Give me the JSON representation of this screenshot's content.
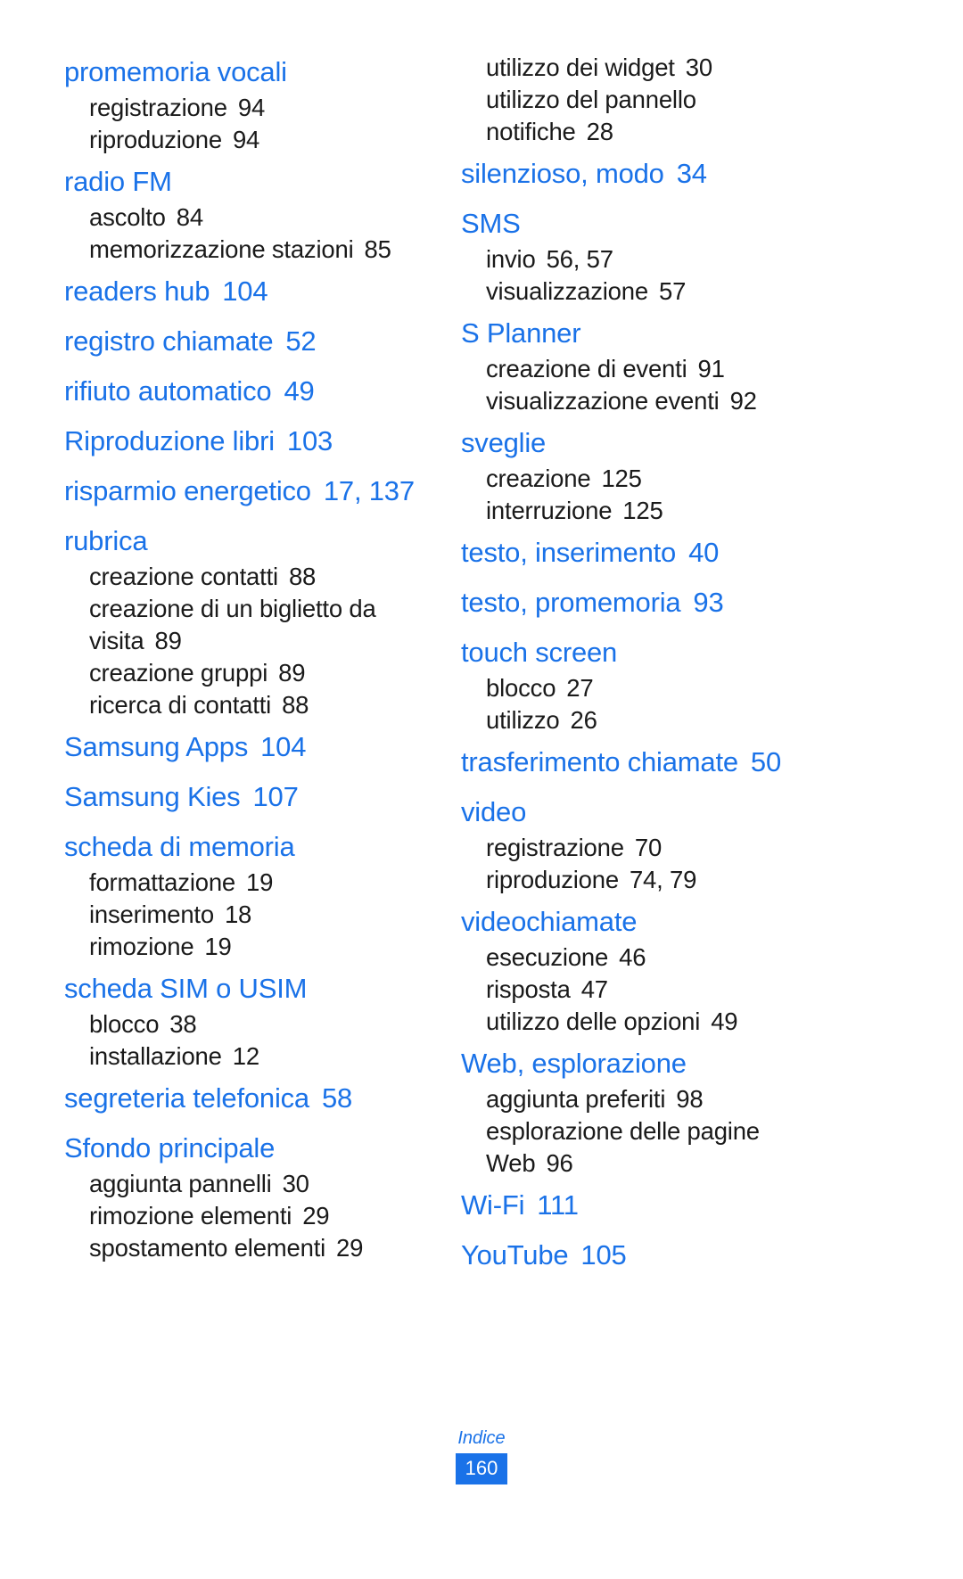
{
  "document": {
    "footer_label": "Indice",
    "page_number": "160",
    "accent_color": "#1a72e8",
    "text_color": "#1a1a1a"
  },
  "columns": [
    {
      "name": "left-column",
      "entries": [
        {
          "head": "promemoria vocali",
          "head_page": "",
          "subs": [
            {
              "label": "registrazione",
              "page": "94"
            },
            {
              "label": "riproduzione",
              "page": "94"
            }
          ]
        },
        {
          "head": "radio FM",
          "head_page": "",
          "subs": [
            {
              "label": "ascolto",
              "page": "84"
            },
            {
              "label": "memorizzazione stazioni",
              "page": "85"
            }
          ]
        },
        {
          "head": "readers hub",
          "head_page": "104",
          "subs": []
        },
        {
          "head": "registro chiamate",
          "head_page": "52",
          "subs": []
        },
        {
          "head": "rifiuto automatico",
          "head_page": "49",
          "subs": []
        },
        {
          "head": "Riproduzione libri",
          "head_page": "103",
          "subs": []
        },
        {
          "head": "risparmio energetico",
          "head_page": "17, 137",
          "subs": []
        },
        {
          "head": "rubrica",
          "head_page": "",
          "subs": [
            {
              "label": "creazione contatti",
              "page": "88"
            },
            {
              "label": "creazione di un biglietto da visita",
              "page": "89"
            },
            {
              "label": "creazione gruppi",
              "page": "89"
            },
            {
              "label": "ricerca di contatti",
              "page": "88"
            }
          ]
        },
        {
          "head": "Samsung Apps",
          "head_page": "104",
          "subs": []
        },
        {
          "head": "Samsung Kies",
          "head_page": "107",
          "subs": []
        },
        {
          "head": "scheda di memoria",
          "head_page": "",
          "subs": [
            {
              "label": "formattazione",
              "page": "19"
            },
            {
              "label": "inserimento",
              "page": "18"
            },
            {
              "label": "rimozione",
              "page": "19"
            }
          ]
        },
        {
          "head": "scheda SIM o USIM",
          "head_page": "",
          "subs": [
            {
              "label": "blocco",
              "page": "38"
            },
            {
              "label": "installazione",
              "page": "12"
            }
          ]
        },
        {
          "head": "segreteria telefonica",
          "head_page": "58",
          "subs": []
        },
        {
          "head": "Sfondo principale",
          "head_page": "",
          "subs": [
            {
              "label": "aggiunta pannelli",
              "page": "30"
            },
            {
              "label": "rimozione elementi",
              "page": "29"
            },
            {
              "label": "spostamento elementi",
              "page": "29"
            }
          ]
        }
      ]
    },
    {
      "name": "right-column",
      "entries": [
        {
          "head": "",
          "head_page": "",
          "subs": [
            {
              "label": "utilizzo dei widget",
              "page": "30"
            },
            {
              "label": "utilizzo del pannello notifiche",
              "page": "28"
            }
          ]
        },
        {
          "head": "silenzioso, modo",
          "head_page": "34",
          "subs": []
        },
        {
          "head": "SMS",
          "head_page": "",
          "subs": [
            {
              "label": "invio",
              "page": "56, 57"
            },
            {
              "label": "visualizzazione",
              "page": "57"
            }
          ]
        },
        {
          "head": "S Planner",
          "head_page": "",
          "subs": [
            {
              "label": "creazione di eventi",
              "page": "91"
            },
            {
              "label": "visualizzazione eventi",
              "page": "92"
            }
          ]
        },
        {
          "head": "sveglie",
          "head_page": "",
          "subs": [
            {
              "label": "creazione",
              "page": "125"
            },
            {
              "label": "interruzione",
              "page": "125"
            }
          ]
        },
        {
          "head": "testo, inserimento",
          "head_page": "40",
          "subs": []
        },
        {
          "head": "testo, promemoria",
          "head_page": "93",
          "subs": []
        },
        {
          "head": "touch screen",
          "head_page": "",
          "subs": [
            {
              "label": "blocco",
              "page": "27"
            },
            {
              "label": "utilizzo",
              "page": "26"
            }
          ]
        },
        {
          "head": "trasferimento chiamate",
          "head_page": "50",
          "subs": []
        },
        {
          "head": "video",
          "head_page": "",
          "subs": [
            {
              "label": "registrazione",
              "page": "70"
            },
            {
              "label": "riproduzione",
              "page": "74, 79"
            }
          ]
        },
        {
          "head": "videochiamate",
          "head_page": "",
          "subs": [
            {
              "label": "esecuzione",
              "page": "46"
            },
            {
              "label": "risposta",
              "page": "47"
            },
            {
              "label": "utilizzo delle opzioni",
              "page": "49"
            }
          ]
        },
        {
          "head": "Web, esplorazione",
          "head_page": "",
          "subs": [
            {
              "label": "aggiunta preferiti",
              "page": "98"
            },
            {
              "label": "esplorazione delle pagine Web",
              "page": "96"
            }
          ]
        },
        {
          "head": "Wi-Fi",
          "head_page": "111",
          "subs": []
        },
        {
          "head": "YouTube",
          "head_page": "105",
          "subs": []
        }
      ]
    }
  ]
}
